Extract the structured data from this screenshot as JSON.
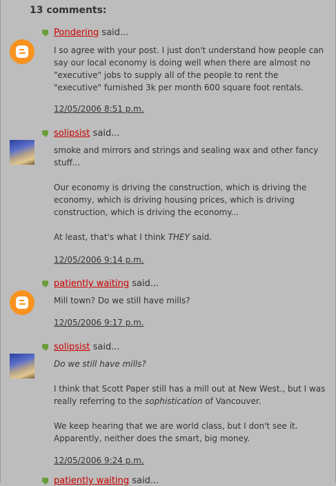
{
  "header": {
    "title": "13 comments:"
  },
  "said": "said...",
  "comments": [
    {
      "author": "Pondering",
      "paragraphs": [
        "I so agree with your post. I just don't understand how people can say our local economy is doing well when there are almost no \"executive\" jobs to supply all of the people to rent the \"executive\" furnished 3k per month 600 square foot rentals."
      ],
      "timestamp": "12/05/2006 8:51 p.m."
    },
    {
      "author": "solipsist",
      "paragraphs": [
        "smoke and mirrors and strings and sealing wax and other fancy stuff...",
        "Our economy is driving the construction, which is driving the economy, which is driving housing prices, which is driving construction, which is driving the economy..."
      ],
      "p3_pre": "At least, that's what I think ",
      "p3_em": "THEY",
      "p3_post": " said.",
      "timestamp": "12/05/2006 9:14 p.m."
    },
    {
      "author": "patiently waiting",
      "paragraphs": [
        "Mill town? Do we still have mills?"
      ],
      "timestamp": "12/05/2006 9:17 p.m."
    },
    {
      "author": "solipsist",
      "quote": "Do we still have mills?",
      "p2_pre": "I think that Scott Paper still has a mill out at New West., but I was really referring to the ",
      "p2_em": "sophistication",
      "p2_post": " of Vancouver.",
      "p3": "We keep hearing that we are world class, but I don't see it. Apparently, neither does the smart, big money.",
      "timestamp": "12/05/2006 9:24 p.m."
    },
    {
      "author": "patiently waiting"
    }
  ]
}
